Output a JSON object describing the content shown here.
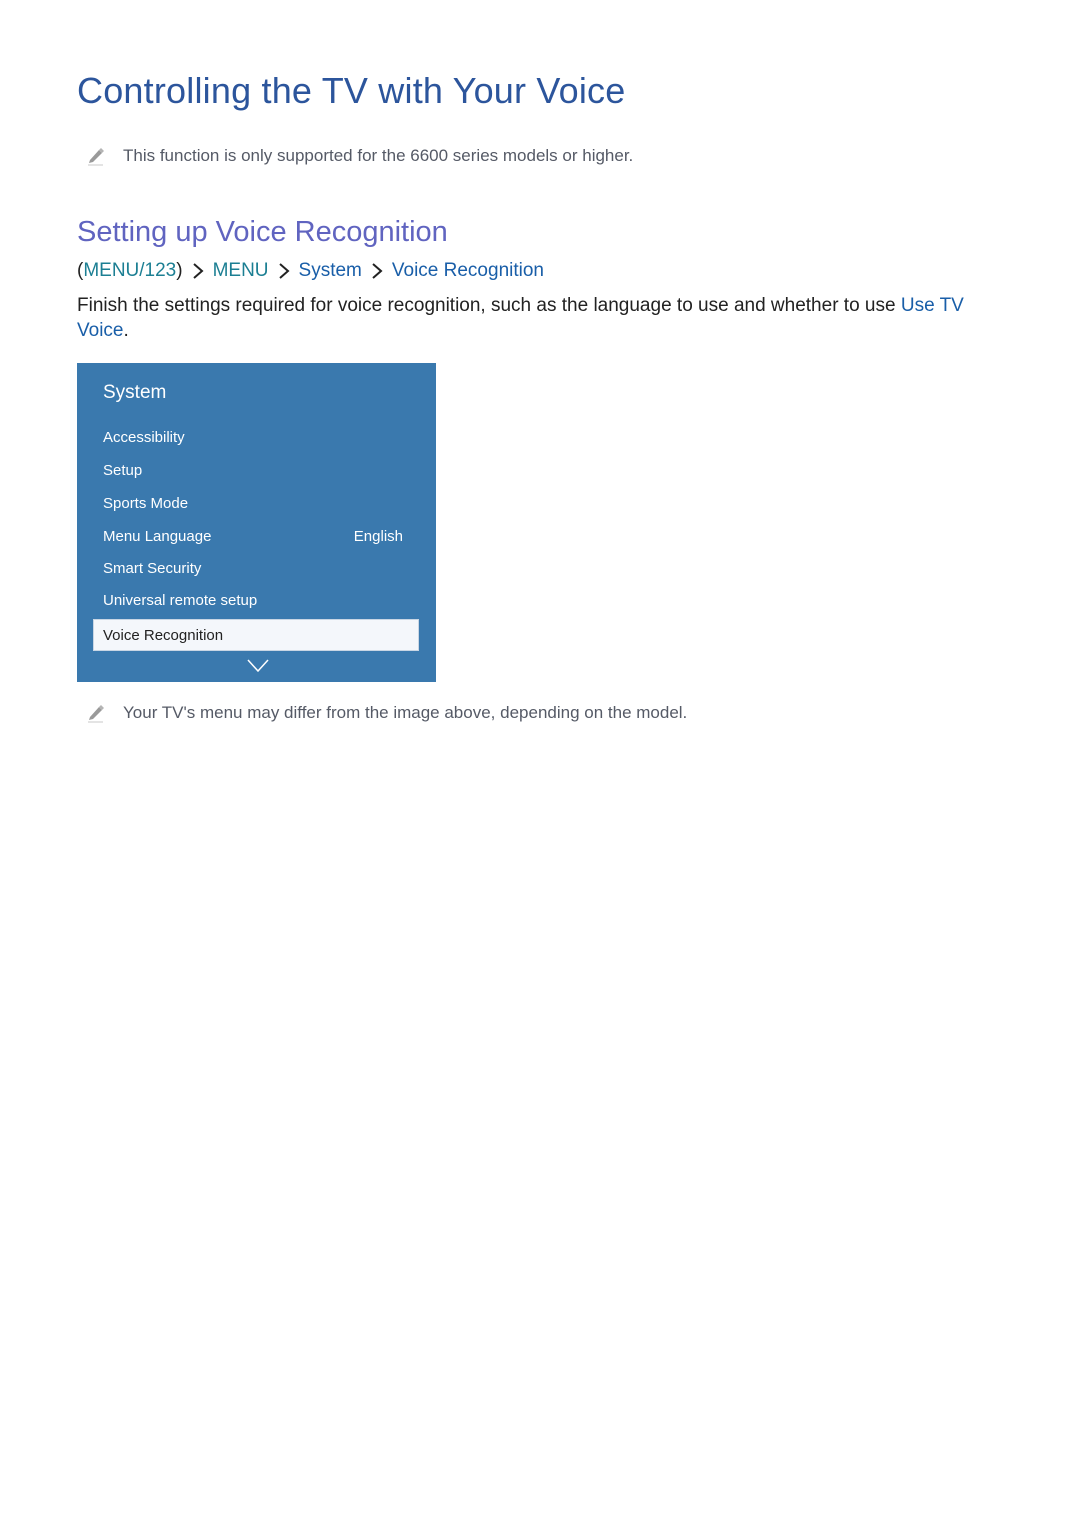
{
  "page": {
    "title": "Controlling the TV with Your Voice",
    "note_top": "This function is only supported for the 6600 series models or higher.",
    "section_title": "Setting up Voice Recognition",
    "breadcrumb": {
      "items": [
        "(MENU/123)",
        "MENU",
        "System",
        "Voice Recognition"
      ]
    },
    "paragraph": {
      "text": "Finish the settings required for voice recognition, such as the language to use and whether to use ",
      "link": "Use TV Voice",
      "end": "."
    },
    "note_bottom": "Your TV's menu may differ from the image above, depending on the model."
  },
  "menu": {
    "title": "System",
    "items": [
      {
        "label": "Accessibility",
        "value": ""
      },
      {
        "label": "Setup",
        "value": ""
      },
      {
        "label": "Sports Mode",
        "value": ""
      },
      {
        "label": "Menu Language",
        "value": "English"
      },
      {
        "label": "Smart Security",
        "value": ""
      },
      {
        "label": "Universal remote setup",
        "value": ""
      }
    ],
    "selected": "Voice Recognition",
    "scroll_icon": "chevron-down-icon"
  },
  "colors": {
    "title": "#2c559c",
    "section_title": "#6064c0",
    "link_blue": "#195ea8",
    "link_teal": "#1c7f93",
    "menu_bg": "#3a79ae"
  }
}
